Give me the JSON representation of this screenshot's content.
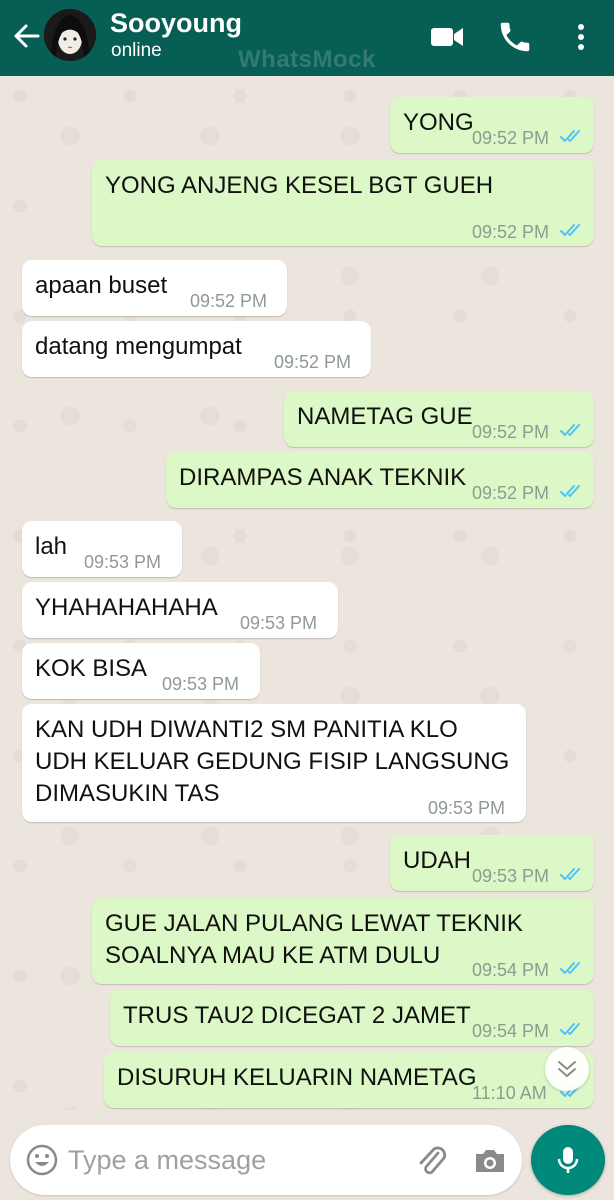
{
  "header": {
    "name": "Sooyoung",
    "status": "online",
    "watermark": "WhatsMock",
    "icons": [
      "back-arrow-icon",
      "avatar",
      "video-call-icon",
      "phone-icon",
      "more-vert-icon"
    ],
    "bg_color": "#075e54"
  },
  "messages": [
    {
      "dir": "out",
      "text": "YONG",
      "time": "09:52 PM",
      "ticks": "read"
    },
    {
      "dir": "out",
      "text": "YONG ANJENG KESEL BGT GUEH",
      "time": "09:52 PM",
      "ticks": "read"
    },
    {
      "dir": "in",
      "text": "apaan buset",
      "time": "09:52 PM"
    },
    {
      "dir": "in",
      "text": "datang mengumpat",
      "time": "09:52 PM"
    },
    {
      "dir": "out",
      "text": "NAMETAG GUE",
      "time": "09:52 PM",
      "ticks": "read"
    },
    {
      "dir": "out",
      "text": "DIRAMPAS ANAK TEKNIK",
      "time": "09:52 PM",
      "ticks": "read"
    },
    {
      "dir": "in",
      "text": "lah",
      "time": "09:53 PM"
    },
    {
      "dir": "in",
      "text": "YHAHAHAHAHA",
      "time": "09:53 PM"
    },
    {
      "dir": "in",
      "text": "KOK BISA",
      "time": "09:53 PM"
    },
    {
      "dir": "in",
      "text": "KAN UDH DIWANTI2 SM PANITIA KLO UDH KELUAR GEDUNG FISIP LANGSUNG DIMASUKIN TAS",
      "time": "09:53 PM"
    },
    {
      "dir": "out",
      "text": "UDAH",
      "time": "09:53 PM",
      "ticks": "read"
    },
    {
      "dir": "out",
      "text": "GUE JALAN PULANG LEWAT TEKNIK SOALNYA MAU KE ATM DULU",
      "time": "09:54 PM",
      "ticks": "read"
    },
    {
      "dir": "out",
      "text": "TRUS TAU2 DICEGAT 2 JAMET",
      "time": "09:54 PM",
      "ticks": "read"
    },
    {
      "dir": "out",
      "text": "DISURUH KELUARIN NAMETAG",
      "time": "11:10 AM",
      "ticks": "read"
    }
  ],
  "input": {
    "placeholder": "Type a message",
    "value": ""
  },
  "colors": {
    "outgoing_bubble": "#dcf8c6",
    "incoming_bubble": "#ffffff",
    "read_ticks": "#4fc3f7",
    "mic_button": "#00897b"
  }
}
